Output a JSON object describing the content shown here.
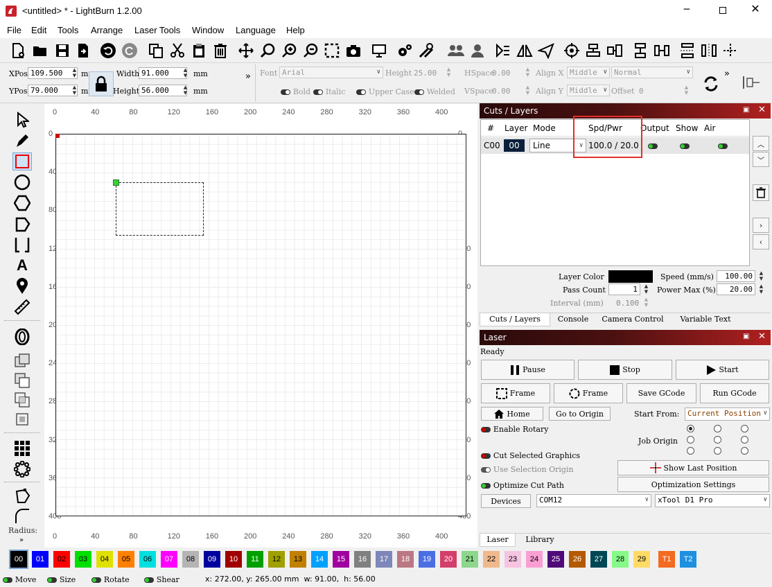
{
  "window": {
    "title": "<untitled> * - LightBurn 1.2.00"
  },
  "menu": [
    "File",
    "Edit",
    "Tools",
    "Arrange",
    "Laser Tools",
    "Window",
    "Language",
    "Help"
  ],
  "props": {
    "xpos_label": "XPos",
    "xpos": "109.500",
    "ypos_label": "YPos",
    "ypos": "79.000",
    "width_label": "Width",
    "width": "91.000",
    "height_label": "Height",
    "height": "56.000",
    "unit": "mm",
    "font_label": "Font",
    "font": "Arial",
    "fheight_label": "Height",
    "fheight": "25.00",
    "hspace_label": "HSpace",
    "hspace": "0.00",
    "vspace_label": "VSpace",
    "vspace": "0.00",
    "alignx_label": "Align X",
    "alignx": "Middle",
    "aligny_label": "Align Y",
    "aligny": "Middle",
    "normal": "Normal",
    "offset_label": "Offset",
    "offset": "0",
    "bold": "Bold",
    "italic": "Italic",
    "upper": "Upper Case",
    "welded": "Welded",
    "more": "»"
  },
  "ruler": {
    "top": [
      "0",
      "40",
      "80",
      "120",
      "160",
      "200",
      "240",
      "280",
      "320",
      "360",
      "400"
    ],
    "left": [
      "0",
      "40",
      "80",
      "120",
      "160",
      "200",
      "240",
      "280",
      "320",
      "360",
      "400"
    ]
  },
  "cuts": {
    "title": "Cuts / Layers",
    "headers": {
      "num": "#",
      "layer": "Layer",
      "mode": "Mode",
      "spd": "Spd/Pwr",
      "output": "Output",
      "show": "Show",
      "air": "Air"
    },
    "row": {
      "id": "C00",
      "layer": "00",
      "mode": "Line",
      "spd": "100.0 / 20.0"
    },
    "layer_color_label": "Layer Color",
    "pass_label": "Pass Count",
    "pass": "1",
    "interval_label": "Interval (mm)",
    "interval": "0.100",
    "speed_label": "Speed (mm/s)",
    "speed": "100.00",
    "power_label": "Power Max (%)",
    "power": "20.00",
    "tabs": [
      "Cuts / Layers",
      "Console",
      "Camera Control",
      "Variable Text"
    ]
  },
  "laser": {
    "title": "Laser",
    "status": "Ready",
    "pause": "Pause",
    "stop": "Stop",
    "start": "Start",
    "frame1": "Frame",
    "frame2": "Frame",
    "save_gcode": "Save GCode",
    "run_gcode": "Run GCode",
    "home": "Home",
    "go_origin": "Go to Origin",
    "start_from_label": "Start From:",
    "start_from": "Current Position",
    "rotary": "Enable Rotary",
    "job_origin": "Job Origin",
    "cut_sel": "Cut Selected Graphics",
    "use_sel": "Use Selection Origin",
    "show_last": "Show Last Position",
    "optimize": "Optimize Cut Path",
    "opt_settings": "Optimization Settings",
    "devices": "Devices",
    "port": "COM12",
    "device": "xTool D1 Pro",
    "tabs": [
      "Laser",
      "Library"
    ]
  },
  "left": {
    "radius": "Radius:"
  },
  "palette": [
    {
      "l": "00",
      "c": "#000000",
      "t": "#ffffff"
    },
    {
      "l": "01",
      "c": "#0000ff",
      "t": "#ffffff"
    },
    {
      "l": "02",
      "c": "#ff0000",
      "t": "#000000"
    },
    {
      "l": "03",
      "c": "#00e000",
      "t": "#000000"
    },
    {
      "l": "04",
      "c": "#e0e000",
      "t": "#000000"
    },
    {
      "l": "05",
      "c": "#ff8000",
      "t": "#000000"
    },
    {
      "l": "06",
      "c": "#00e0e0",
      "t": "#000000"
    },
    {
      "l": "07",
      "c": "#ff00ff",
      "t": "#ffffff"
    },
    {
      "l": "08",
      "c": "#b4b4b4",
      "t": "#000000"
    },
    {
      "l": "09",
      "c": "#0000a0",
      "t": "#ffffff"
    },
    {
      "l": "10",
      "c": "#a00000",
      "t": "#ffffff"
    },
    {
      "l": "11",
      "c": "#00a000",
      "t": "#ffffff"
    },
    {
      "l": "12",
      "c": "#a0a000",
      "t": "#000000"
    },
    {
      "l": "13",
      "c": "#c08000",
      "t": "#000000"
    },
    {
      "l": "14",
      "c": "#00a0ff",
      "t": "#ffffff"
    },
    {
      "l": "15",
      "c": "#a000a0",
      "t": "#ffffff"
    },
    {
      "l": "16",
      "c": "#808080",
      "t": "#ffffff"
    },
    {
      "l": "17",
      "c": "#7d87b9",
      "t": "#ffffff"
    },
    {
      "l": "18",
      "c": "#bb7784",
      "t": "#ffffff"
    },
    {
      "l": "19",
      "c": "#4a6fe3",
      "t": "#ffffff"
    },
    {
      "l": "20",
      "c": "#d33f6a",
      "t": "#ffffff"
    },
    {
      "l": "21",
      "c": "#8cd78c",
      "t": "#000000"
    },
    {
      "l": "22",
      "c": "#f0b98d",
      "t": "#000000"
    },
    {
      "l": "23",
      "c": "#f6c4e1",
      "t": "#000000"
    },
    {
      "l": "24",
      "c": "#fa9ed4",
      "t": "#000000"
    },
    {
      "l": "25",
      "c": "#500a78",
      "t": "#ffffff"
    },
    {
      "l": "26",
      "c": "#b45a00",
      "t": "#ffffff"
    },
    {
      "l": "27",
      "c": "#004754",
      "t": "#ffffff"
    },
    {
      "l": "28",
      "c": "#86fa88",
      "t": "#000000"
    },
    {
      "l": "29",
      "c": "#ffdb66",
      "t": "#000000"
    },
    {
      "l": "T1",
      "c": "#f36a21",
      "t": "#ffffff"
    },
    {
      "l": "T2",
      "c": "#1e90e0",
      "t": "#ffffff"
    }
  ],
  "status": {
    "move": "Move",
    "size": "Size",
    "rotate": "Rotate",
    "shear": "Shear",
    "coords": "x: 272.00, y: 265.00 mm  w: 91.00,  h: 56.00"
  }
}
